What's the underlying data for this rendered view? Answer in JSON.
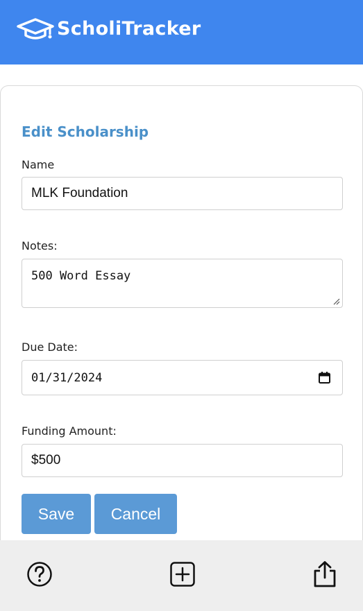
{
  "header": {
    "app_name": "ScholiTracker",
    "logo_icon": "graduation-cap-icon",
    "background_color": "#3f86ee"
  },
  "form": {
    "title": "Edit Scholarship",
    "name": {
      "label": "Name",
      "value": "MLK Foundation"
    },
    "notes": {
      "label": "Notes:",
      "value": "500 Word Essay"
    },
    "due_date": {
      "label": "Due Date:",
      "value": "01/31/2024",
      "icon": "calendar-icon"
    },
    "funding": {
      "label": "Funding Amount:",
      "value": "$500"
    },
    "save_label": "Save",
    "cancel_label": "Cancel",
    "button_color": "#5b9ad6",
    "title_color": "#4a90c9"
  },
  "bottom_nav": {
    "items": [
      {
        "name": "help",
        "icon": "help-circle-icon"
      },
      {
        "name": "add",
        "icon": "plus-square-icon"
      },
      {
        "name": "share",
        "icon": "share-icon"
      }
    ]
  }
}
